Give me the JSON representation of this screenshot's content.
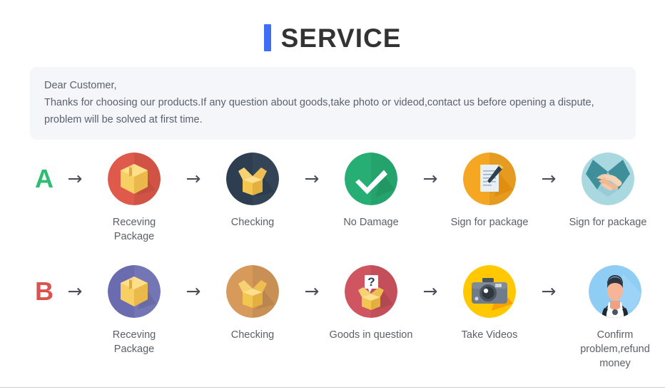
{
  "header": {
    "accent_color": "#3d6ef5",
    "title": "SERVICE"
  },
  "notice": {
    "background_color": "#f4f6f9",
    "lines": [
      "Dear Customer,",
      "Thanks for choosing our products.If any question about goods,take photo or videod,contact us before opening a dispute,",
      "problem will be solved at first time."
    ]
  },
  "arrow_glyph": "→",
  "flows": [
    {
      "letter": "A",
      "letter_color": "#2ebd72",
      "steps": [
        {
          "label": "Receving Package",
          "icon": "package-box-icon",
          "circle_color": "#e05a4c"
        },
        {
          "label": "Checking",
          "icon": "open-box-icon",
          "circle_color": "#2c3e50"
        },
        {
          "label": "No Damage",
          "icon": "checkmark-icon",
          "circle_color": "#27ae74"
        },
        {
          "label": "Sign for package",
          "icon": "document-pen-icon",
          "circle_color": "#f5a623"
        },
        {
          "label": "Sign for package",
          "icon": "handshake-icon",
          "circle_color": "#a9d8e0"
        }
      ]
    },
    {
      "letter": "B",
      "letter_color": "#d9534f",
      "steps": [
        {
          "label": "Receving Package",
          "icon": "package-box-icon",
          "circle_color": "#6b6cb0"
        },
        {
          "label": "Checking",
          "icon": "open-box-icon",
          "circle_color": "#d79a5b"
        },
        {
          "label": "Goods in question",
          "icon": "question-box-icon",
          "circle_color": "#cf5560"
        },
        {
          "label": "Take Videos",
          "icon": "camera-icon",
          "circle_color": "#ffc800"
        },
        {
          "label": "Confirm problem,refund money",
          "icon": "support-person-icon",
          "circle_color": "#8fcdf5"
        }
      ]
    }
  ]
}
